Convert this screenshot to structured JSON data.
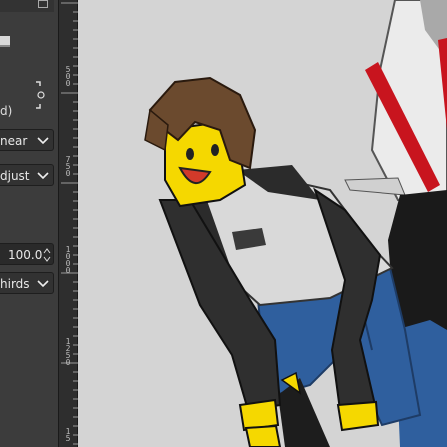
{
  "left_panel": {
    "interpolation_value": "near",
    "clipping_value": "djust",
    "opacity_value": "100.0",
    "guides_value": "hirds",
    "truncated_label": "d)"
  },
  "ruler": {
    "labels": [
      "5\n0\n0",
      "7\n5\n0",
      "1\n0\n0\n0",
      "1\n2\n5\n0",
      "1\n5"
    ]
  },
  "colors": {
    "panel_bg": "#3c3c3c",
    "canvas_bg": "#d4d4d4",
    "character_skin": "#f5d800",
    "shorts_blue": "#2f5f9e",
    "suspenders_red": "#c8141e"
  }
}
